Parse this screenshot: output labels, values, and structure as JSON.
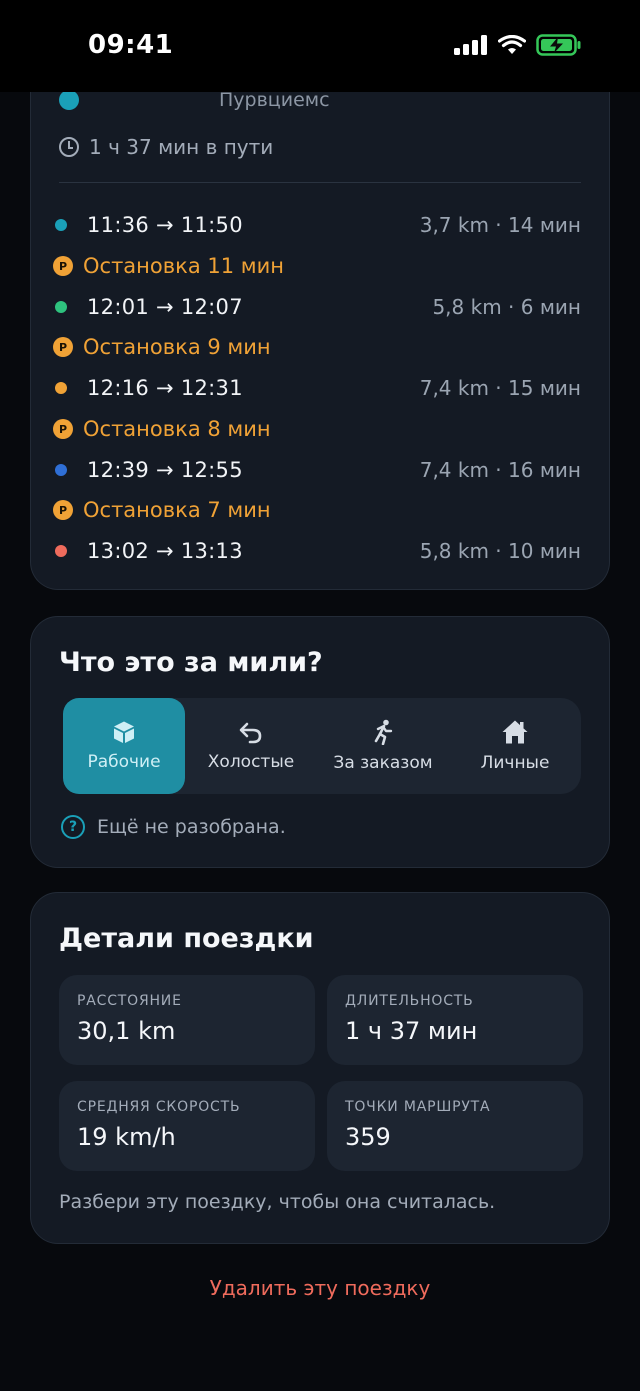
{
  "status_bar": {
    "time": "09:41"
  },
  "route": {
    "destination": "Пурвциемс",
    "duration_text": "1 ч 37 мин в пути",
    "items": [
      {
        "kind": "segment",
        "color": "#1aa0b8",
        "time": "11:36 → 11:50",
        "meta": "3,7 km · 14 мин"
      },
      {
        "kind": "stop",
        "text": "Остановка 11 мин"
      },
      {
        "kind": "segment",
        "color": "#2ec27e",
        "time": "12:01 → 12:07",
        "meta": "5,8 km · 6 мин"
      },
      {
        "kind": "stop",
        "text": "Остановка 9 мин"
      },
      {
        "kind": "segment",
        "color": "#f0a236",
        "time": "12:16 → 12:31",
        "meta": "7,4 km · 15 мин"
      },
      {
        "kind": "stop",
        "text": "Остановка 8 мин"
      },
      {
        "kind": "segment",
        "color": "#2f6fd6",
        "time": "12:39 → 12:55",
        "meta": "7,4 km · 16 мин"
      },
      {
        "kind": "stop",
        "text": "Остановка 7 мин"
      },
      {
        "kind": "segment",
        "color": "#ef6b5c",
        "time": "13:02 → 13:13",
        "meta": "5,8 km · 10 мин"
      }
    ],
    "stop_badge": "P"
  },
  "miles": {
    "title": "Что это за мили?",
    "options": [
      {
        "label": "Рабочие",
        "icon": "box-icon",
        "active": true
      },
      {
        "label": "Холостые",
        "icon": "undo-arrow-icon",
        "active": false
      },
      {
        "label": "За заказом",
        "icon": "runner-icon",
        "active": false
      },
      {
        "label": "Личные",
        "icon": "home-icon",
        "active": false
      }
    ],
    "status": "Ещё не разобрана.",
    "status_icon": "?"
  },
  "details": {
    "title": "Детали поездки",
    "stats": [
      {
        "label": "РАССТОЯНИЕ",
        "value": "30,1 km"
      },
      {
        "label": "ДЛИТЕЛЬНОСТЬ",
        "value": "1 ч 37 мин"
      },
      {
        "label": "СРЕДНЯЯ СКОРОСТЬ",
        "value": "19 km/h"
      },
      {
        "label": "ТОЧКИ МАРШРУТА",
        "value": "359"
      }
    ],
    "hint": "Разбери эту поездку, чтобы она считалась."
  },
  "actions": {
    "delete_label": "Удалить эту поездку"
  }
}
